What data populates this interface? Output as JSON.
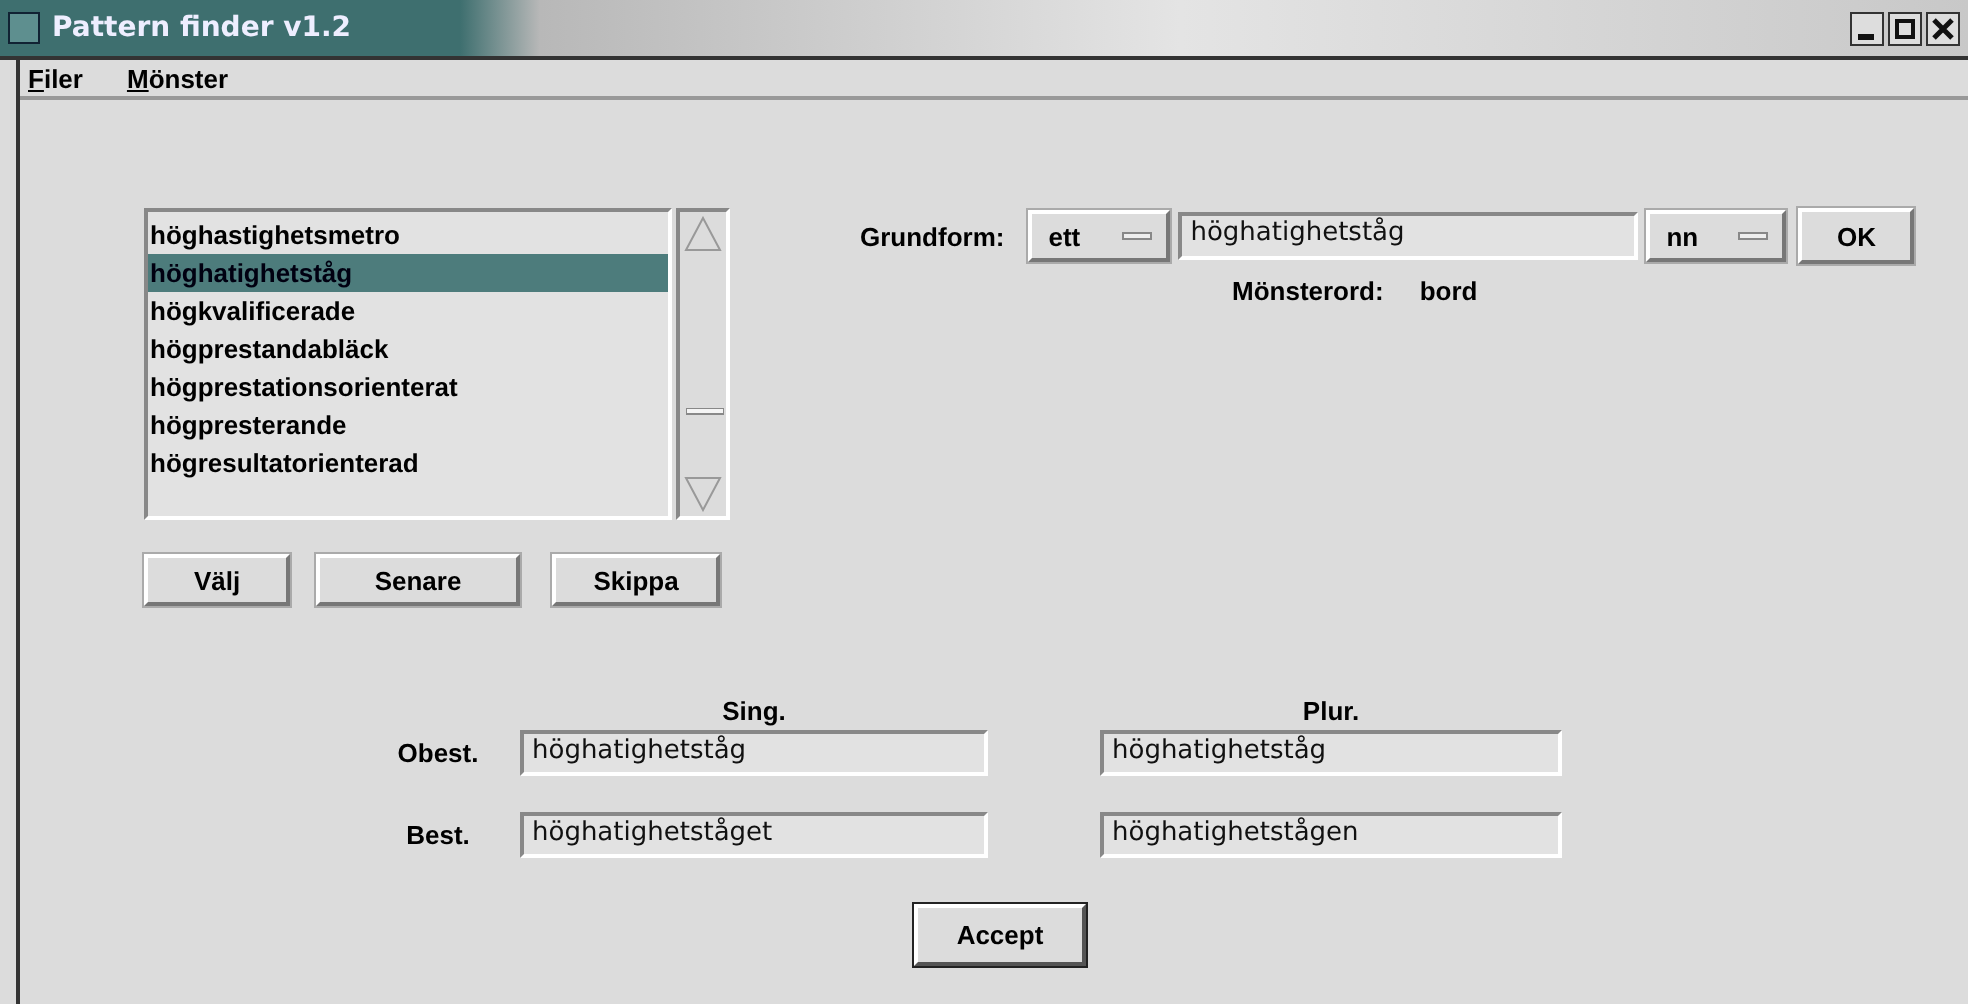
{
  "window": {
    "title": "Pattern finder v1.2"
  },
  "menu": [
    {
      "label": "Filer"
    },
    {
      "label": "Mönster"
    }
  ],
  "word_list": [
    {
      "label": "höghastighetsmetro",
      "selected": false
    },
    {
      "label": "höghatighetståg",
      "selected": true
    },
    {
      "label": "högkvalificerade",
      "selected": false
    },
    {
      "label": "högprestandabläck",
      "selected": false
    },
    {
      "label": "högprestationsorienterat",
      "selected": false
    },
    {
      "label": "högpresterande",
      "selected": false
    },
    {
      "label": "högresultatorienterad",
      "selected": false
    }
  ],
  "list_buttons": [
    "Välj",
    "Senare",
    "Skippa"
  ],
  "grundform": {
    "label": "Grundform:",
    "article": "ett",
    "value": "höghatighetståg",
    "gender": "nn",
    "ok": "OK"
  },
  "pattern": {
    "label": "Mönsterord:",
    "value": "bord"
  },
  "forms": {
    "columns": [
      "Sing.",
      "Plur."
    ],
    "rows": [
      {
        "label": "Obest.",
        "values": [
          "höghatighetståg",
          "höghatighetståg"
        ]
      },
      {
        "label": "Best.",
        "values": [
          "höghatighetståget",
          "höghatighetstågen"
        ]
      }
    ]
  },
  "accept": "Accept"
}
